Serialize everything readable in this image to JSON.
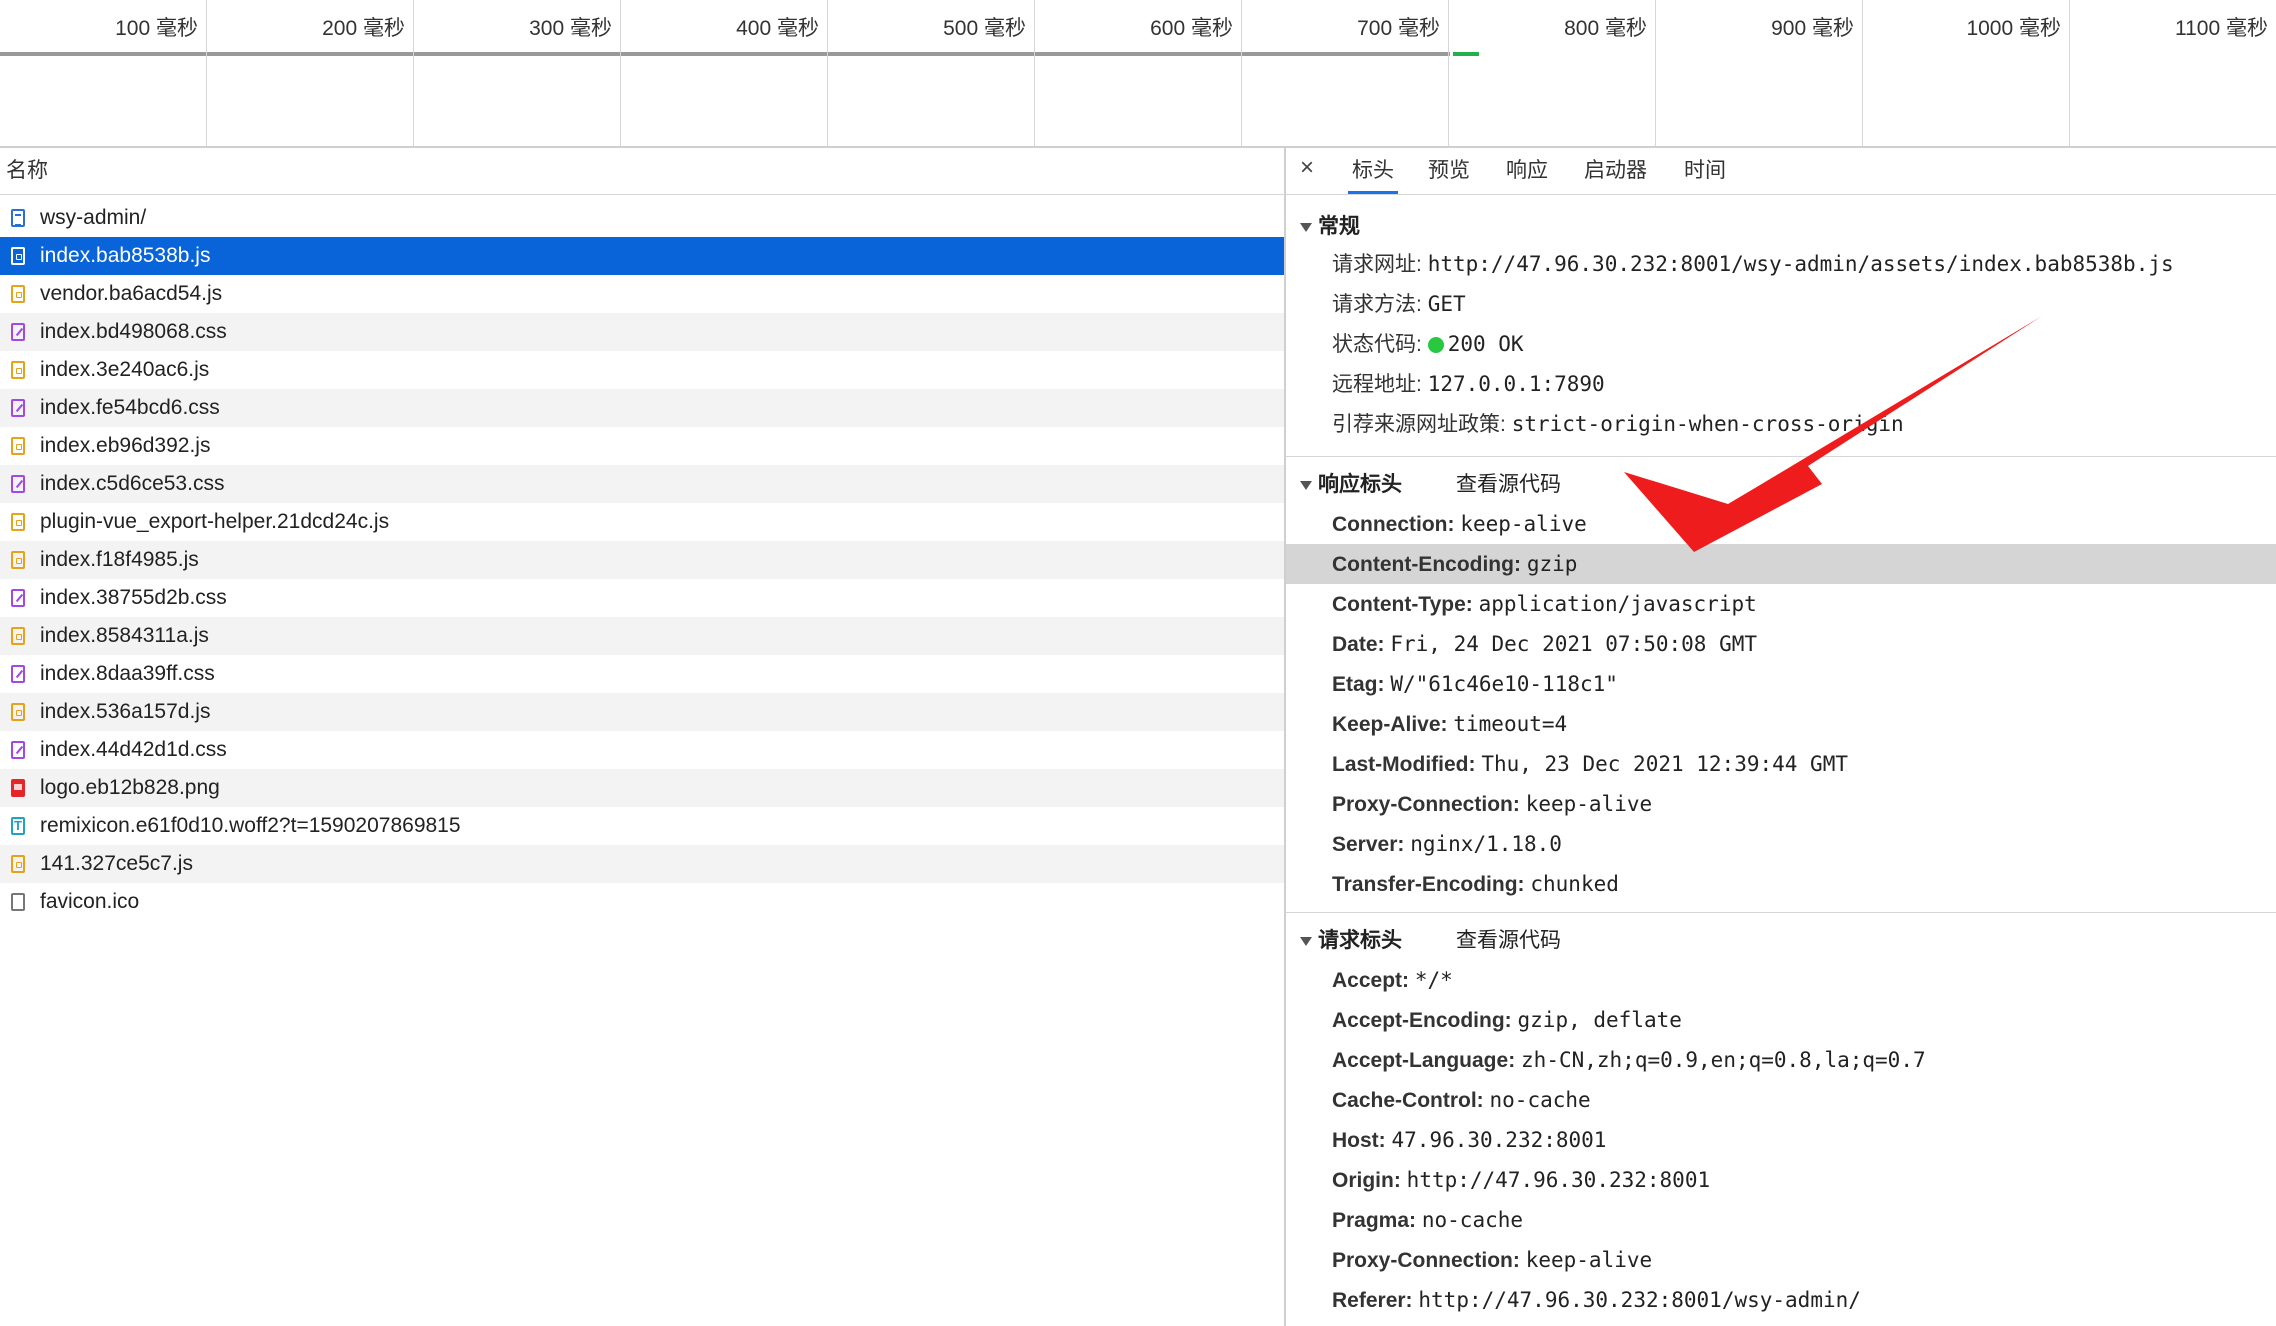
{
  "timeline": {
    "ticks": [
      "100 毫秒",
      "200 毫秒",
      "300 毫秒",
      "400 毫秒",
      "500 毫秒",
      "600 毫秒",
      "700 毫秒",
      "800 毫秒",
      "900 毫秒",
      "1000 毫秒",
      "1100 毫秒"
    ]
  },
  "request_list": {
    "header": "名称",
    "rows": [
      {
        "name": "wsy-admin/",
        "type": "doc"
      },
      {
        "name": "index.bab8538b.js",
        "type": "js",
        "selected": true
      },
      {
        "name": "vendor.ba6acd54.js",
        "type": "js"
      },
      {
        "name": "index.bd498068.css",
        "type": "css"
      },
      {
        "name": "index.3e240ac6.js",
        "type": "js"
      },
      {
        "name": "index.fe54bcd6.css",
        "type": "css"
      },
      {
        "name": "index.eb96d392.js",
        "type": "js"
      },
      {
        "name": "index.c5d6ce53.css",
        "type": "css"
      },
      {
        "name": "plugin-vue_export-helper.21dcd24c.js",
        "type": "js"
      },
      {
        "name": "index.f18f4985.js",
        "type": "js"
      },
      {
        "name": "index.38755d2b.css",
        "type": "css"
      },
      {
        "name": "index.8584311a.js",
        "type": "js"
      },
      {
        "name": "index.8daa39ff.css",
        "type": "css"
      },
      {
        "name": "index.536a157d.js",
        "type": "js"
      },
      {
        "name": "index.44d42d1d.css",
        "type": "css"
      },
      {
        "name": "logo.eb12b828.png",
        "type": "img"
      },
      {
        "name": "remixicon.e61f0d10.woff2?t=1590207869815",
        "type": "font"
      },
      {
        "name": "141.327ce5c7.js",
        "type": "js"
      },
      {
        "name": "favicon.ico",
        "type": "other"
      }
    ]
  },
  "details": {
    "close": "×",
    "tabs": [
      "标头",
      "预览",
      "响应",
      "启动器",
      "时间"
    ],
    "general": {
      "title": "常规",
      "items": [
        {
          "k": "请求网址:",
          "v": "http://47.96.30.232:8001/wsy-admin/assets/index.bab8538b.js"
        },
        {
          "k": "请求方法:",
          "v": "GET"
        },
        {
          "k": "状态代码:",
          "v": "200 OK",
          "status": true
        },
        {
          "k": "远程地址:",
          "v": "127.0.0.1:7890"
        },
        {
          "k": "引荐来源网址政策:",
          "v": "strict-origin-when-cross-origin"
        }
      ]
    },
    "response_headers": {
      "title": "响应标头",
      "view_source": "查看源代码",
      "items": [
        {
          "k": "Connection:",
          "v": "keep-alive"
        },
        {
          "k": "Content-Encoding:",
          "v": "gzip",
          "highlight": true
        },
        {
          "k": "Content-Type:",
          "v": "application/javascript"
        },
        {
          "k": "Date:",
          "v": "Fri, 24 Dec 2021 07:50:08 GMT"
        },
        {
          "k": "Etag:",
          "v": "W/\"61c46e10-118c1\""
        },
        {
          "k": "Keep-Alive:",
          "v": "timeout=4"
        },
        {
          "k": "Last-Modified:",
          "v": "Thu, 23 Dec 2021 12:39:44 GMT"
        },
        {
          "k": "Proxy-Connection:",
          "v": "keep-alive"
        },
        {
          "k": "Server:",
          "v": "nginx/1.18.0"
        },
        {
          "k": "Transfer-Encoding:",
          "v": "chunked"
        }
      ]
    },
    "request_headers": {
      "title": "请求标头",
      "view_source": "查看源代码",
      "items": [
        {
          "k": "Accept:",
          "v": "*/*"
        },
        {
          "k": "Accept-Encoding:",
          "v": "gzip, deflate"
        },
        {
          "k": "Accept-Language:",
          "v": "zh-CN,zh;q=0.9,en;q=0.8,la;q=0.7"
        },
        {
          "k": "Cache-Control:",
          "v": "no-cache"
        },
        {
          "k": "Host:",
          "v": "47.96.30.232:8001"
        },
        {
          "k": "Origin:",
          "v": "http://47.96.30.232:8001"
        },
        {
          "k": "Pragma:",
          "v": "no-cache"
        },
        {
          "k": "Proxy-Connection:",
          "v": "keep-alive"
        },
        {
          "k": "Referer:",
          "v": "http://47.96.30.232:8001/wsy-admin/"
        }
      ]
    }
  },
  "annotation": {
    "arrow_color": "#ee1c1c"
  },
  "colors": {
    "selected_row": "#0963d9",
    "status_ok": "#28c940",
    "highlight_row": "#d5d5d5"
  }
}
